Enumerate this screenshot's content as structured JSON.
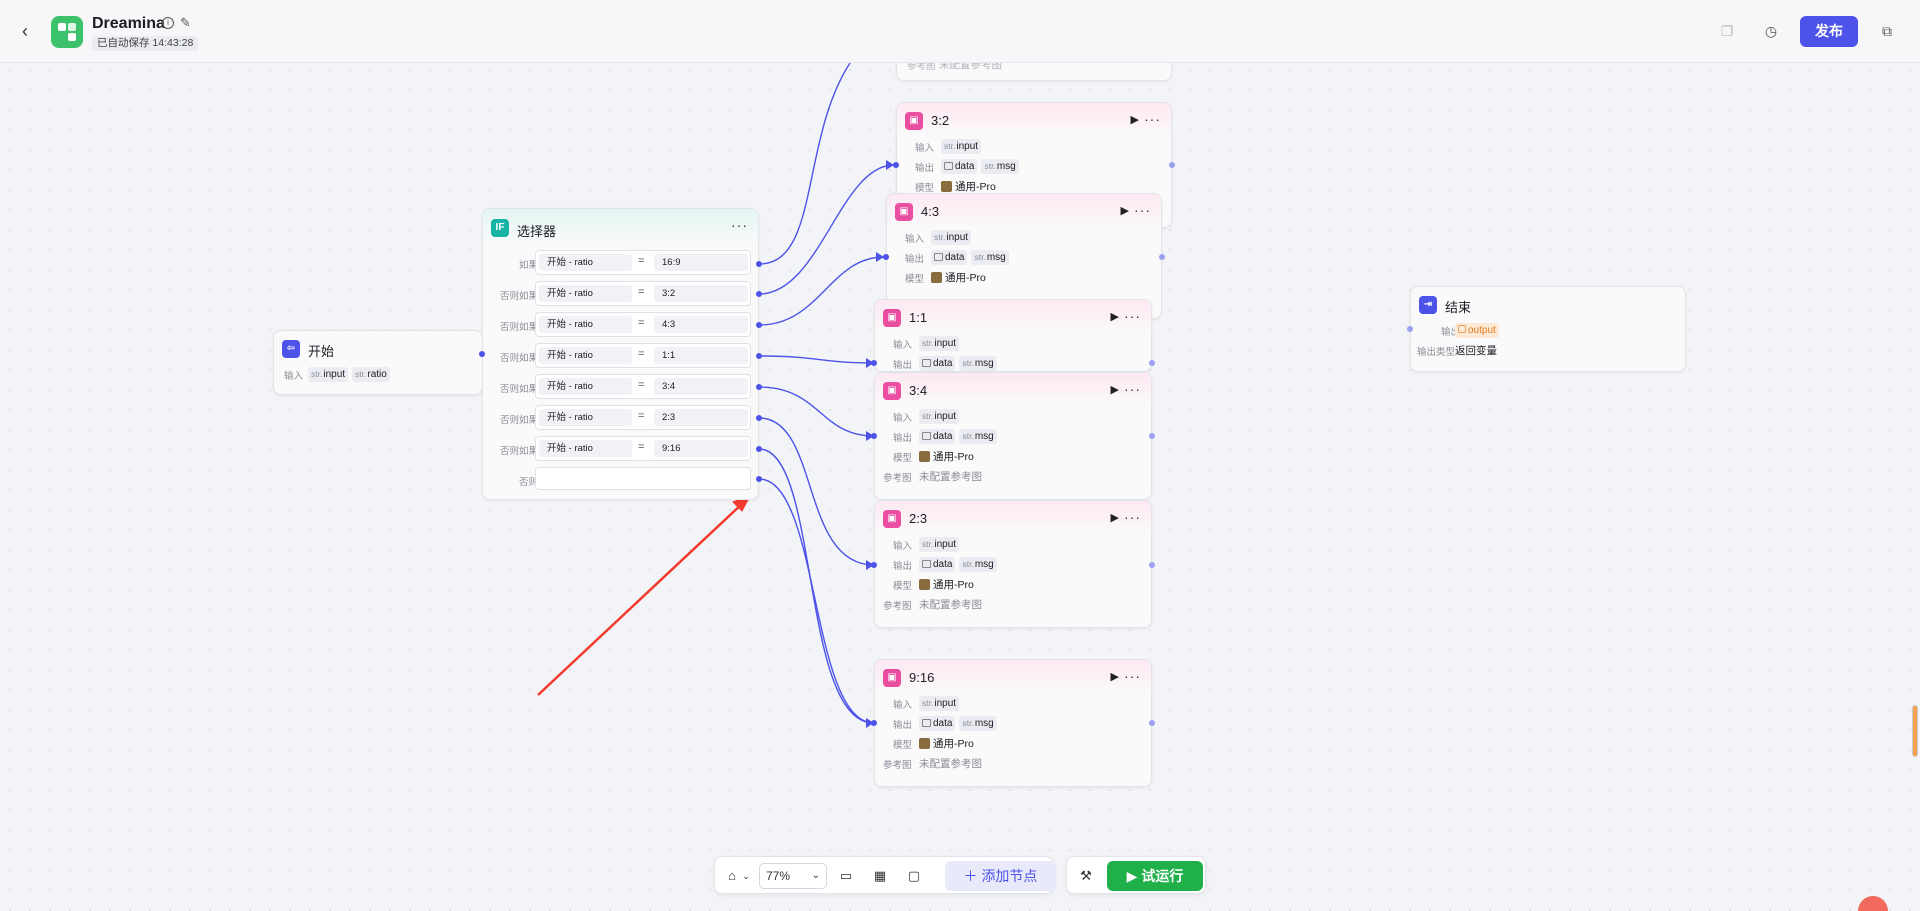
{
  "header": {
    "app_name": "Dreamina",
    "save_status": "已自动保存 14:43:28",
    "publish_label": "发布"
  },
  "start_node": {
    "title": "开始",
    "input_label": "输入",
    "inputs": [
      {
        "type": "str.",
        "name": "input"
      },
      {
        "type": "str.",
        "name": "ratio"
      }
    ]
  },
  "selector_node": {
    "title": "选择器",
    "icon_text": "IF",
    "conditions": [
      {
        "label": "如果",
        "left": "开始 - ratio",
        "op": "=",
        "right": "16:9"
      },
      {
        "label": "否则如果",
        "left": "开始 - ratio",
        "op": "=",
        "right": "3:2"
      },
      {
        "label": "否则如果",
        "left": "开始 - ratio",
        "op": "=",
        "right": "4:3"
      },
      {
        "label": "否则如果",
        "left": "开始 - ratio",
        "op": "=",
        "right": "1:1"
      },
      {
        "label": "否则如果",
        "left": "开始 - ratio",
        "op": "=",
        "right": "3:4"
      },
      {
        "label": "否则如果",
        "left": "开始 - ratio",
        "op": "=",
        "right": "2:3"
      },
      {
        "label": "否则如果",
        "left": "开始 - ratio",
        "op": "=",
        "right": "9:16"
      }
    ],
    "else_label": "否则"
  },
  "top_partial": {
    "ref_label": "参考图",
    "ref_value": "未配置参考图"
  },
  "image_nodes": [
    {
      "title": "3:2",
      "input_label": "输入",
      "input_type": "str.",
      "input_name": "input",
      "output_label": "输出",
      "out_data": "data",
      "out_type": "str.",
      "out_msg": "msg",
      "model_label": "模型",
      "model": "通用-Pro"
    },
    {
      "title": "4:3",
      "input_label": "输入",
      "input_type": "str.",
      "input_name": "input",
      "output_label": "输出",
      "out_data": "data",
      "out_type": "str.",
      "out_msg": "msg",
      "model_label": "模型",
      "model": "通用-Pro"
    },
    {
      "title": "1:1",
      "input_label": "输入",
      "input_type": "str.",
      "input_name": "input",
      "output_label": "输出",
      "out_data": "data",
      "out_type": "str.",
      "out_msg": "msg"
    },
    {
      "title": "3:4",
      "input_label": "输入",
      "input_type": "str.",
      "input_name": "input",
      "output_label": "输出",
      "out_data": "data",
      "out_type": "str.",
      "out_msg": "msg",
      "model_label": "模型",
      "model": "通用-Pro",
      "ref_label": "参考图",
      "ref_value": "未配置参考图"
    },
    {
      "title": "2:3",
      "input_label": "输入",
      "input_type": "str.",
      "input_name": "input",
      "output_label": "输出",
      "out_data": "data",
      "out_type": "str.",
      "out_msg": "msg",
      "model_label": "模型",
      "model": "通用-Pro",
      "ref_label": "参考图",
      "ref_value": "未配置参考图"
    },
    {
      "title": "9:16",
      "input_label": "输入",
      "input_type": "str.",
      "input_name": "input",
      "output_label": "输出",
      "out_data": "data",
      "out_type": "str.",
      "out_msg": "msg",
      "model_label": "模型",
      "model": "通用-Pro",
      "ref_label": "参考图",
      "ref_value": "未配置参考图"
    }
  ],
  "end_node": {
    "title": "结束",
    "output_label": "输出",
    "output_name": "output",
    "output_type_label": "输出类型",
    "output_type_value": "返回变量"
  },
  "toolbar": {
    "zoom": "77%",
    "add_node_label": "添加节点",
    "test_run_label": "试运行"
  },
  "colors": {
    "accent": "#4d53e8",
    "edge": "#4d53e8",
    "image_node": "#e94ea1",
    "selector_node": "#18b3a4",
    "run": "#1fb04a",
    "annotation_arrow": "#f23a2f"
  }
}
